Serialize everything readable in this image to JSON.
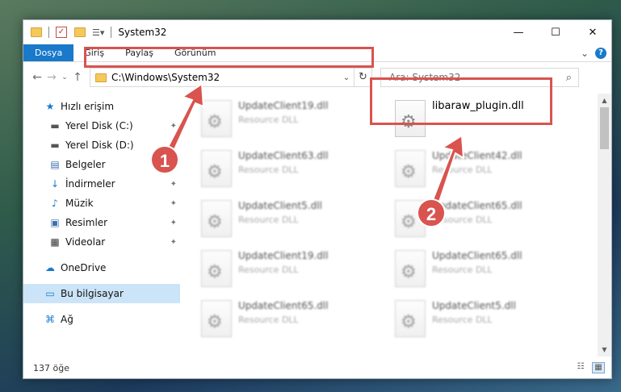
{
  "window": {
    "title": "System32",
    "controls": {
      "minimize": "—",
      "maximize": "☐",
      "close": "✕"
    }
  },
  "ribbon": {
    "tabs": [
      "Dosya",
      "Giriş",
      "Paylaş",
      "Görünüm"
    ],
    "help": "?",
    "collapse": "⌄"
  },
  "nav": {
    "back": "←",
    "forward": "→",
    "recent": "⌄",
    "up": "↑",
    "address": "C:\\Windows\\System32",
    "dropdown": "⌄",
    "refresh": "↻",
    "search_placeholder": "Ara: System32",
    "search_icon": "⌕"
  },
  "sidebar": {
    "items": [
      {
        "label": "Hızlı erişim",
        "icon": "star-icon",
        "glyph": "★",
        "color": "#1979ca",
        "pinned": false
      },
      {
        "label": "Yerel Disk (C:)",
        "icon": "drive-icon",
        "glyph": "▬",
        "color": "#555555",
        "pinned": true
      },
      {
        "label": "Yerel Disk (D:)",
        "icon": "drive-icon",
        "glyph": "▬",
        "color": "#555555",
        "pinned": true
      },
      {
        "label": "Belgeler",
        "icon": "documents-icon",
        "glyph": "▤",
        "color": "#3d6fb0",
        "pinned": true
      },
      {
        "label": "İndirmeler",
        "icon": "downloads-icon",
        "glyph": "↓",
        "color": "#1979ca",
        "pinned": true
      },
      {
        "label": "Müzik",
        "icon": "music-icon",
        "glyph": "♪",
        "color": "#1979ca",
        "pinned": true
      },
      {
        "label": "Resimler",
        "icon": "pictures-icon",
        "glyph": "▣",
        "color": "#3d6fb0",
        "pinned": true
      },
      {
        "label": "Videolar",
        "icon": "videos-icon",
        "glyph": "▦",
        "color": "#333333",
        "pinned": true
      },
      {
        "label": "OneDrive",
        "icon": "cloud-icon",
        "glyph": "☁",
        "color": "#1979ca",
        "pinned": false
      },
      {
        "label": "Bu bilgisayar",
        "icon": "computer-icon",
        "glyph": "▭",
        "color": "#1979ca",
        "pinned": false
      },
      {
        "label": "Ağ",
        "icon": "network-icon",
        "glyph": "⌘",
        "color": "#1979ca",
        "pinned": false
      }
    ],
    "pin_glyph": "📌"
  },
  "files": [
    {
      "name": "UpdateClient19.dll",
      "type": "Resource DLL"
    },
    {
      "name": "libaraw_plugin.dll",
      "type": ""
    },
    {
      "name": "UpdateClient63.dll",
      "type": "Resource DLL"
    },
    {
      "name": "UpdateClient42.dll",
      "type": "Resource DLL"
    },
    {
      "name": "UpdateClient5.dll",
      "type": "Resource DLL"
    },
    {
      "name": "UpdateClient65.dll",
      "type": "Resource DLL"
    },
    {
      "name": "UpdateClient19.dll",
      "type": "Resource DLL"
    },
    {
      "name": "UpdateClient65.dll",
      "type": "Resource DLL"
    },
    {
      "name": "UpdateClient65.dll",
      "type": "Resource DLL"
    },
    {
      "name": "UpdateClient5.dll",
      "type": "Resource DLL"
    }
  ],
  "status": {
    "count": "137 öğe"
  },
  "annotations": {
    "step1": "1",
    "step2": "2",
    "color": "#d9534f"
  }
}
